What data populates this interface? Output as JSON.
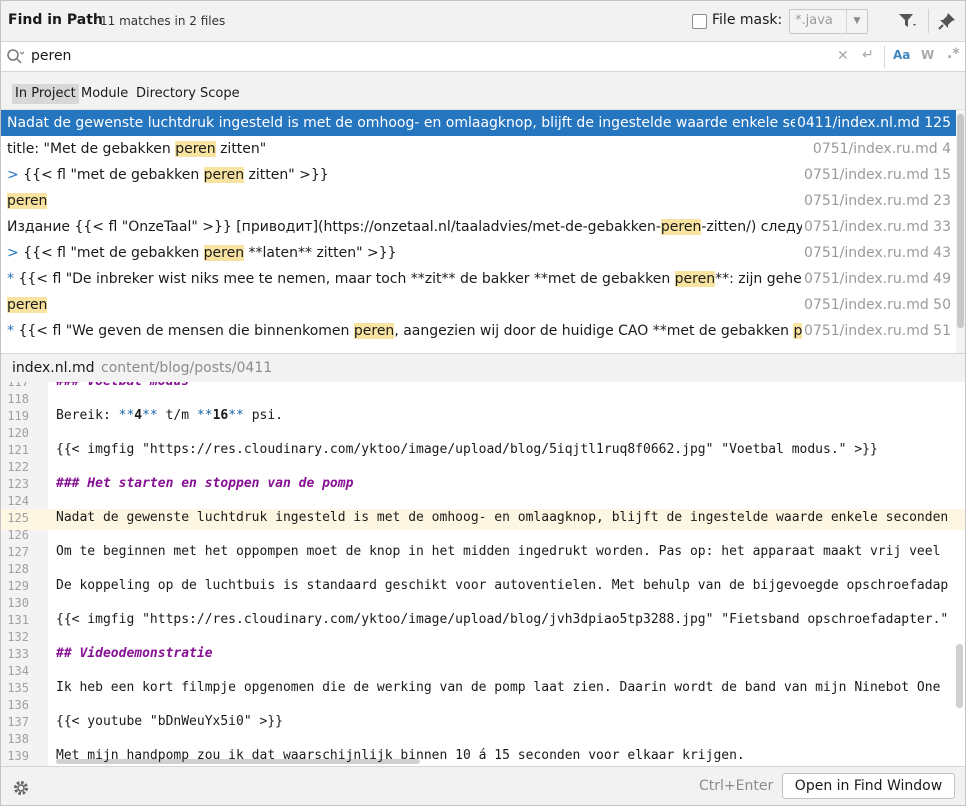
{
  "header": {
    "title": "Find in Path",
    "matches": "11 matches in 2 files",
    "file_mask_label": "File mask:",
    "file_mask_value": "*.java"
  },
  "search": {
    "query": "peren",
    "case_label": "Aa",
    "word_label": "W",
    "regex_label": ".*"
  },
  "scopes": [
    {
      "label": "In Project",
      "active": true
    },
    {
      "label": "Module",
      "active": false
    },
    {
      "label": "Directory",
      "active": false
    },
    {
      "label": "Scope",
      "active": false
    }
  ],
  "results": [
    {
      "parts": [
        {
          "t": "Nadat de gewenste luchtdruk ingesteld is met de omhoog- en omlaagknop, blijft de ingestelde waarde enkele second"
        }
      ],
      "file": "0411/index.nl.md",
      "line": "125",
      "selected": true
    },
    {
      "parts": [
        {
          "t": "title: \"Met de gebakken "
        },
        {
          "t": "peren",
          "m": true
        },
        {
          "t": " zitten\""
        }
      ],
      "file": "0751/index.ru.md",
      "line": "4"
    },
    {
      "parts": [
        {
          "t": "> ",
          "gt": true
        },
        {
          "t": "{{< fl \"met de gebakken "
        },
        {
          "t": "peren",
          "m": true
        },
        {
          "t": " zitten\" >}}"
        }
      ],
      "file": "0751/index.ru.md",
      "line": "15"
    },
    {
      "parts": [
        {
          "t": "peren",
          "m": true
        }
      ],
      "file": "0751/index.ru.md",
      "line": "23"
    },
    {
      "parts": [
        {
          "t": "Издание {{< fl \"OnzeTaal\" >}} [приводит](https://onzetaal.nl/taaladvies/met-de-gebakken-"
        },
        {
          "t": "peren",
          "m": true
        },
        {
          "t": "-zitten/) следующие о"
        }
      ],
      "file": "0751/index.ru.md",
      "line": "33"
    },
    {
      "parts": [
        {
          "t": "> ",
          "gt": true
        },
        {
          "t": "{{< fl \"met de gebakken "
        },
        {
          "t": "peren",
          "m": true
        },
        {
          "t": " **laten** zitten\" >}}"
        }
      ],
      "file": "0751/index.ru.md",
      "line": "43"
    },
    {
      "parts": [
        {
          "t": "* ",
          "gt": true
        },
        {
          "t": "{{< fl \"De inbreker wist niks mee te nemen, maar toch **zit** de bakker **met de gebakken "
        },
        {
          "t": "peren",
          "m": true
        },
        {
          "t": "**: zijn gehele ruit we"
        }
      ],
      "file": "0751/index.ru.md",
      "line": "49"
    },
    {
      "parts": [
        {
          "t": "peren",
          "m": true
        }
      ],
      "file": "0751/index.ru.md",
      "line": "50"
    },
    {
      "parts": [
        {
          "t": "* ",
          "gt": true
        },
        {
          "t": "{{< fl \"We geven de mensen die binnenkomen "
        },
        {
          "t": "peren",
          "m": true
        },
        {
          "t": ", aangezien wij door de huidige CAO **met de gebakken "
        },
        {
          "t": "peren",
          "m": true
        },
        {
          "t": " zitt"
        }
      ],
      "file": "0751/index.ru.md",
      "line": "51"
    }
  ],
  "preview": {
    "file": "index.nl.md",
    "path": "content/blog/posts/0411"
  },
  "editor_lines": [
    {
      "n": "117",
      "segs": [
        {
          "t": "### Voetbal modus",
          "c": "h"
        }
      ]
    },
    {
      "n": "118",
      "segs": []
    },
    {
      "n": "119",
      "segs": [
        {
          "t": "Bereik: "
        },
        {
          "t": "**",
          "c": "b"
        },
        {
          "t": "4",
          "c": "bb"
        },
        {
          "t": "**",
          "c": "b"
        },
        {
          "t": " t/m "
        },
        {
          "t": "**",
          "c": "b"
        },
        {
          "t": "16",
          "c": "bb"
        },
        {
          "t": "**",
          "c": "b"
        },
        {
          "t": " psi."
        }
      ]
    },
    {
      "n": "120",
      "segs": []
    },
    {
      "n": "121",
      "segs": [
        {
          "t": "{{< imgfig \"https://res.cloudinary.com/yktoo/image/upload/blog/5iqjtl1ruq8f0662.jpg\" \"Voetbal modus.\" >}}"
        }
      ]
    },
    {
      "n": "122",
      "segs": []
    },
    {
      "n": "123",
      "segs": [
        {
          "t": "### Het starten en stoppen van de pomp",
          "c": "h"
        }
      ]
    },
    {
      "n": "124",
      "segs": []
    },
    {
      "n": "125",
      "segs": [
        {
          "t": "Nadat de gewenste luchtdruk ingesteld is met de omhoog- en omlaagknop, blijft de ingestelde waarde enkele seconden"
        }
      ]
    },
    {
      "n": "126",
      "segs": []
    },
    {
      "n": "127",
      "segs": [
        {
          "t": "Om te beginnen met het oppompen moet de knop in het midden ingedrukt worden. Pas op: het apparaat maakt vrij veel"
        }
      ]
    },
    {
      "n": "128",
      "segs": []
    },
    {
      "n": "129",
      "segs": [
        {
          "t": "De koppeling op de luchtbuis is standaard geschikt voor autoventielen. Met behulp van de bijgevoegde opschroefadap"
        }
      ]
    },
    {
      "n": "130",
      "segs": []
    },
    {
      "n": "131",
      "segs": [
        {
          "t": "{{< imgfig \"https://res.cloudinary.com/yktoo/image/upload/blog/jvh3dpiao5tp3288.jpg\" \"Fietsband opschroefadapter.\""
        }
      ]
    },
    {
      "n": "132",
      "segs": []
    },
    {
      "n": "133",
      "segs": [
        {
          "t": "## Videodemonstratie",
          "c": "h"
        }
      ]
    },
    {
      "n": "134",
      "segs": []
    },
    {
      "n": "135",
      "segs": [
        {
          "t": "Ik heb een kort filmpje opgenomen die de werking van de pomp laat zien. Daarin wordt de band van mijn Ninebot One"
        }
      ]
    },
    {
      "n": "136",
      "segs": []
    },
    {
      "n": "137",
      "segs": [
        {
          "t": "{{< youtube \"bDnWeuYx5i0\" >}}"
        }
      ]
    },
    {
      "n": "138",
      "segs": []
    },
    {
      "n": "139",
      "segs": [
        {
          "t": "Met mijn handpomp zou ik dat waarschijnlijk binnen 10 á 15 seconden voor elkaar krijgen."
        }
      ]
    }
  ],
  "footer": {
    "shortcut": "Ctrl+Enter",
    "open_button": "Open in Find Window"
  },
  "icons": [
    "search-icon",
    "clear-icon",
    "newline-icon",
    "filter-icon",
    "pin-icon",
    "gear-icon",
    "chevron-down-icon"
  ],
  "colors": {
    "selection": "#2675bf",
    "match_highlight": "#f8e3a1",
    "markdown_heading": "#871094",
    "current_line": "#fdf6e3"
  }
}
